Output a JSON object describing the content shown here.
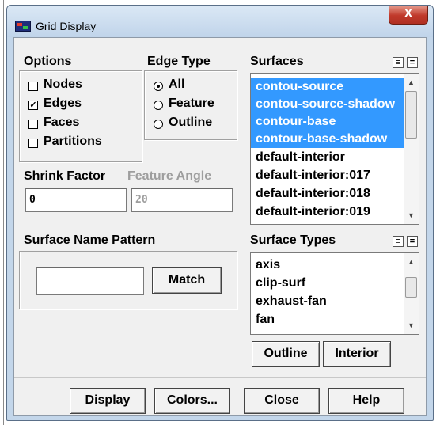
{
  "window": {
    "title": "Grid Display",
    "close_label": "X"
  },
  "options": {
    "title": "Options",
    "items": [
      {
        "label": "Nodes",
        "checked": false,
        "mark": ""
      },
      {
        "label": "Edges",
        "checked": true,
        "mark": "✓"
      },
      {
        "label": "Faces",
        "checked": false,
        "mark": ""
      },
      {
        "label": "Partitions",
        "checked": false,
        "mark": ""
      }
    ]
  },
  "edge_type": {
    "title": "Edge Type",
    "items": [
      {
        "label": "All",
        "selected": true
      },
      {
        "label": "Feature",
        "selected": false
      },
      {
        "label": "Outline",
        "selected": false
      }
    ]
  },
  "shrink": {
    "label": "Shrink Factor",
    "value": "0"
  },
  "feature_angle": {
    "label": "Feature Angle",
    "value": "20"
  },
  "surfaces": {
    "title": "Surfaces",
    "select_all_icon": "≡",
    "deselect_icon": "=",
    "items": [
      {
        "label": "contou-source",
        "selected": true
      },
      {
        "label": "contou-source-shadow",
        "selected": true
      },
      {
        "label": "contour-base",
        "selected": true
      },
      {
        "label": "contour-base-shadow",
        "selected": true
      },
      {
        "label": "default-interior",
        "selected": false
      },
      {
        "label": "default-interior:017",
        "selected": false
      },
      {
        "label": "default-interior:018",
        "selected": false
      },
      {
        "label": "default-interior:019",
        "selected": false
      }
    ]
  },
  "pattern": {
    "title": "Surface Name Pattern",
    "value": "",
    "match_label": "Match"
  },
  "surface_types": {
    "title": "Surface Types",
    "select_all_icon": "≡",
    "deselect_icon": "=",
    "items": [
      {
        "label": "axis"
      },
      {
        "label": "clip-surf"
      },
      {
        "label": "exhaust-fan"
      },
      {
        "label": "fan"
      }
    ],
    "outline_label": "Outline",
    "interior_label": "Interior"
  },
  "footer": {
    "display_label": "Display",
    "colors_label": "Colors...",
    "close_label": "Close",
    "help_label": "Help"
  },
  "colors": {
    "selection": "#3399ff",
    "title_bar": "#c3d6ea",
    "close_button": "#c0392b",
    "dialog_bg": "#f0f0f0"
  }
}
